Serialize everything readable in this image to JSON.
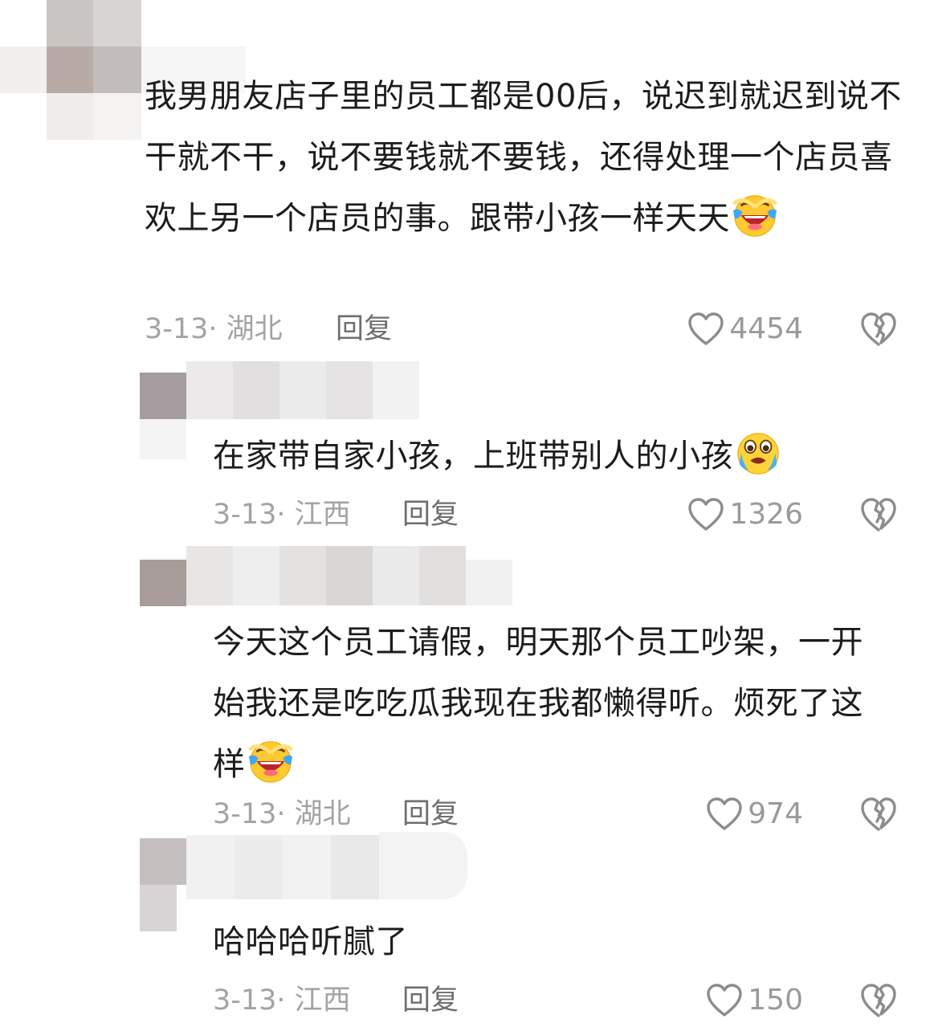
{
  "comments": [
    {
      "text": "我男朋友店子里的员工都是00后，说迟到就迟到说不干就不干，说不要钱就不要钱，还得处理一个店员喜欢上另一个店员的事。跟带小孩一样天天",
      "emoji": "laughing-crying-emoji",
      "meta": "3-13· 湖北",
      "reply": "回复",
      "likes": "4454"
    },
    {
      "text": "在家带自家小孩，上班带别人的小孩",
      "emoji": "crying-emoji",
      "meta": "3-13· 江西",
      "reply": "回复",
      "likes": "1326"
    },
    {
      "text": "今天这个员工请假，明天那个员工吵架，一开始我还是吃吃瓜我现在我都懒得听。烦死了这样",
      "emoji": "laughing-crying-emoji",
      "meta": "3-13· 湖北",
      "reply": "回复",
      "likes": "974"
    },
    {
      "text": "哈哈哈听腻了",
      "emoji": "",
      "meta": "3-13· 江西",
      "reply": "回复",
      "likes": "150"
    }
  ],
  "icons": {
    "like": "heart-outline-icon",
    "dislike": "broken-heart-icon"
  },
  "colors": {
    "meta": "#a3a3a3",
    "reply": "#6e6e6e",
    "icon": "#8c8c8c"
  }
}
